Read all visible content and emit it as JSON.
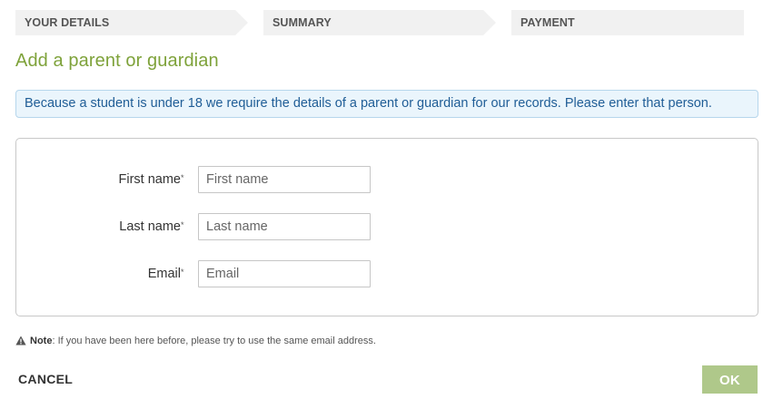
{
  "steps": [
    {
      "label": "YOUR DETAILS"
    },
    {
      "label": "SUMMARY"
    },
    {
      "label": "PAYMENT"
    }
  ],
  "title": "Add a parent or guardian",
  "info_message": "Because a student is under 18 we require the details of a parent or guardian for our records. Please enter that person.",
  "form": {
    "required_marker": "*",
    "fields": [
      {
        "label": "First name",
        "placeholder": "First name",
        "value": ""
      },
      {
        "label": "Last name",
        "placeholder": "Last name",
        "value": ""
      },
      {
        "label": "Email",
        "placeholder": "Email",
        "value": ""
      }
    ]
  },
  "note": {
    "icon": "warning-icon",
    "label": "Note",
    "text": ": If you have been here before, please try to use the same email address."
  },
  "buttons": {
    "cancel": "CANCEL",
    "ok": "OK"
  },
  "colors": {
    "title_green": "#7ea23a",
    "info_text_blue": "#1f5d96",
    "info_bg": "#eaf5fc",
    "ok_button_bg": "#afc88a",
    "step_bg": "#f1f1f1"
  }
}
